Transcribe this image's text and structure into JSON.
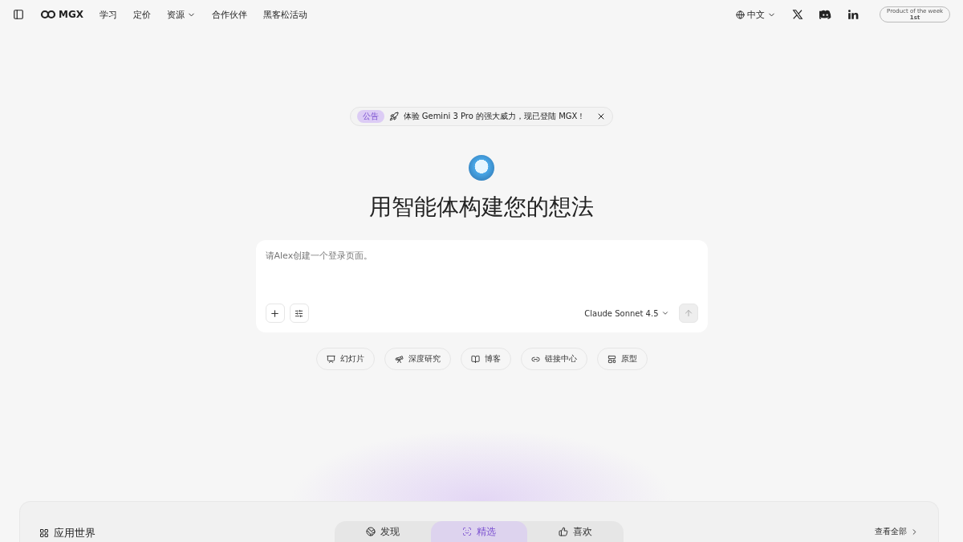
{
  "nav": {
    "logo": "MGX",
    "links": [
      {
        "label": "学习",
        "dropdown": false
      },
      {
        "label": "定价",
        "dropdown": false
      },
      {
        "label": "资源",
        "dropdown": true
      },
      {
        "label": "合作伙伴",
        "dropdown": false
      },
      {
        "label": "黑客松活动",
        "dropdown": false
      }
    ],
    "language": "中文",
    "award": {
      "line_1": "Product of the week",
      "line_2": "1st"
    }
  },
  "announcement": {
    "tag": "公告",
    "text": "体验 Gemini 3 Pro 的强大威力，现已登陆 MGX！"
  },
  "headline": "用智能体构建您的想法",
  "prompt": {
    "placeholder": "请Alex创建一个登录页面。",
    "model": "Claude Sonnet 4.5"
  },
  "chips": [
    {
      "kind": "slides",
      "label": "幻灯片"
    },
    {
      "kind": "research",
      "label": "深度研究"
    },
    {
      "kind": "blog",
      "label": "博客"
    },
    {
      "kind": "links",
      "label": "链接中心"
    },
    {
      "kind": "prototype",
      "label": "原型"
    }
  ],
  "app_world": {
    "title": "应用世界",
    "tabs": [
      {
        "kind": "discover",
        "label": "发现",
        "selected": false
      },
      {
        "kind": "featured",
        "label": "精选",
        "selected": true
      },
      {
        "kind": "liked",
        "label": "喜欢",
        "selected": false
      }
    ],
    "view_all": "查看全部"
  }
}
